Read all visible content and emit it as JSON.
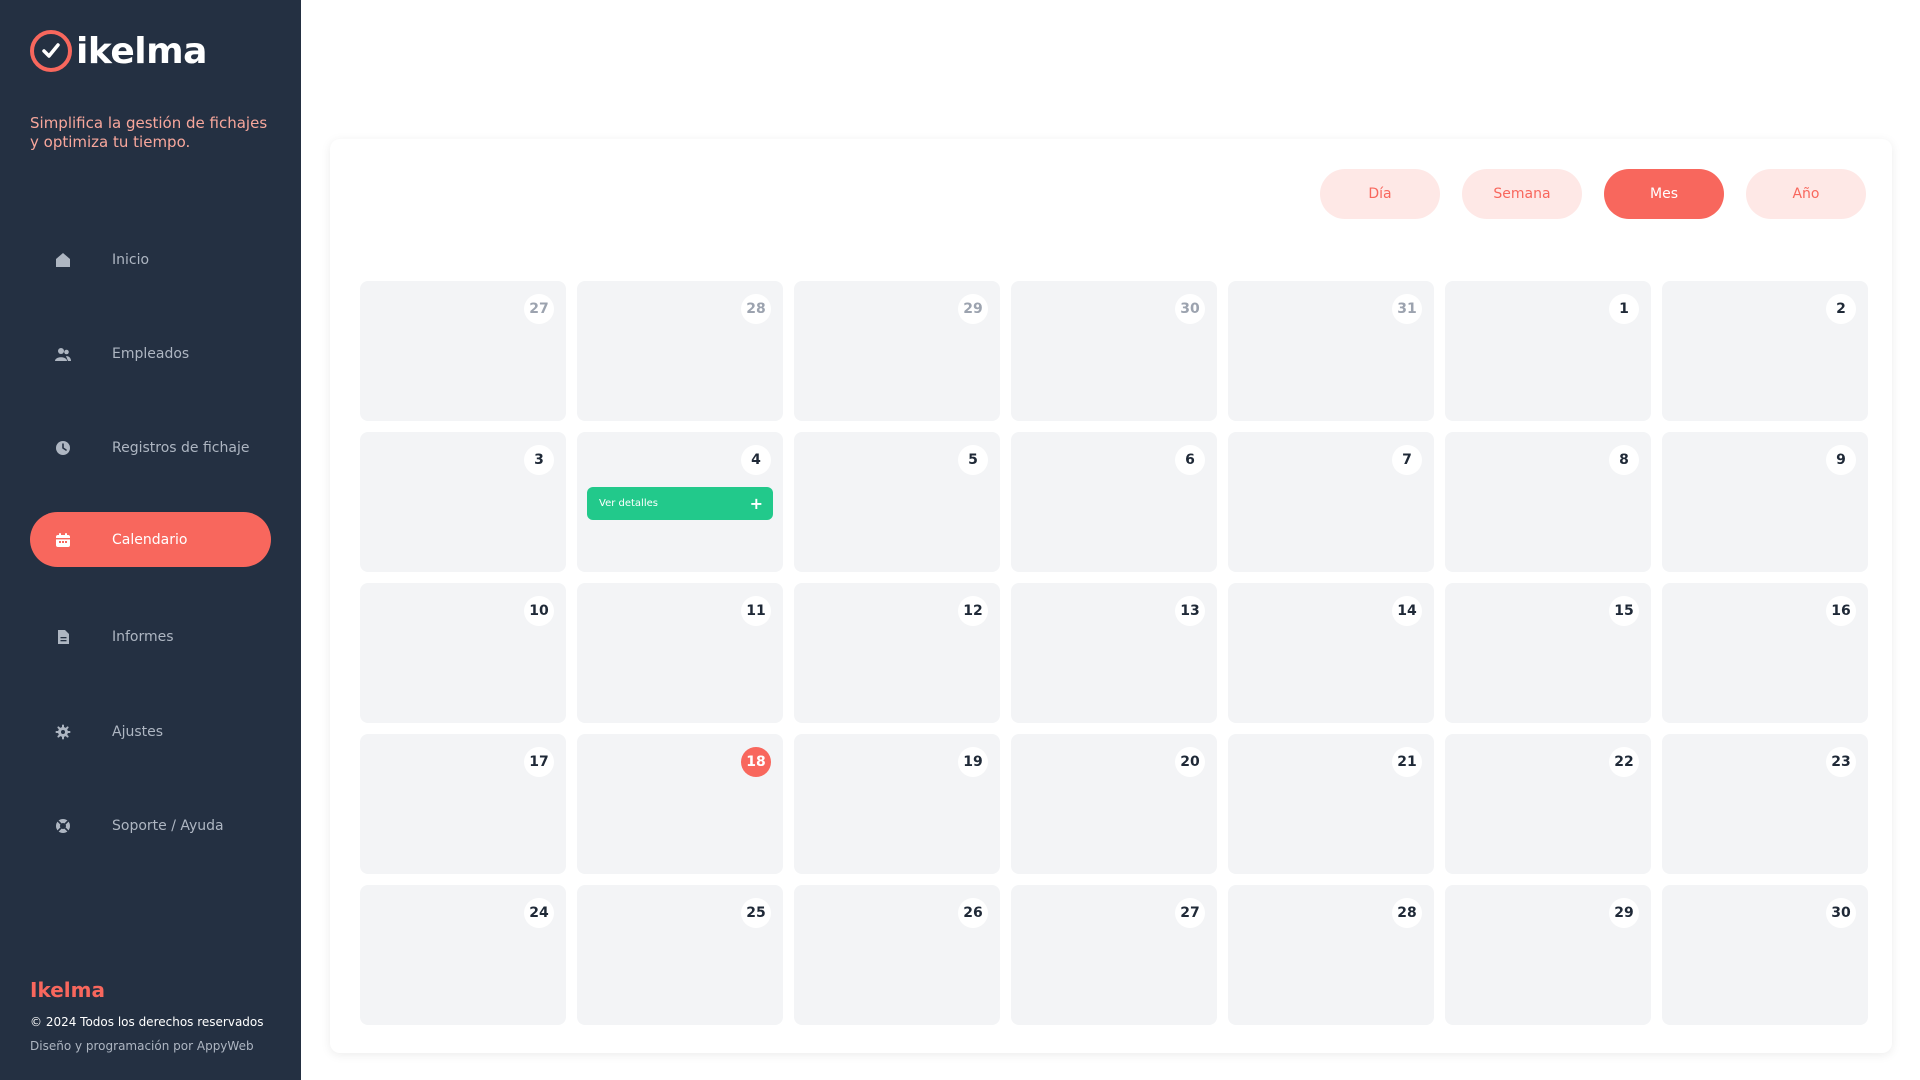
{
  "brand": {
    "name": "ikelma",
    "tagline": "Simplifica la gestión de fichajes y optimiza tu tiempo."
  },
  "nav": {
    "items": [
      {
        "label": "Inicio",
        "icon": "home-icon"
      },
      {
        "label": "Empleados",
        "icon": "users-icon"
      },
      {
        "label": "Registros de fichaje",
        "icon": "clock-icon"
      },
      {
        "label": "Calendario",
        "icon": "calendar-icon",
        "active": true
      },
      {
        "label": "Informes",
        "icon": "file-icon"
      },
      {
        "label": "Ajustes",
        "icon": "gear-icon"
      },
      {
        "label": "Soporte / Ayuda",
        "icon": "lifebuoy-icon"
      }
    ]
  },
  "footer": {
    "brand": "Ikelma",
    "copyright": "© 2024 Todos los derechos reservados",
    "credit": "Diseño y programación por AppyWeb"
  },
  "views": {
    "dia": "Día",
    "semana": "Semana",
    "mes": "Mes",
    "ano": "Año",
    "active": "Mes"
  },
  "calendar": {
    "days": [
      "27",
      "28",
      "29",
      "30",
      "31",
      "1",
      "2",
      "3",
      "4",
      "5",
      "6",
      "7",
      "8",
      "9",
      "10",
      "11",
      "12",
      "13",
      "14",
      "15",
      "16",
      "17",
      "18",
      "19",
      "20",
      "21",
      "22",
      "23",
      "24",
      "25",
      "26",
      "27",
      "28",
      "29",
      "30"
    ],
    "muted_count": 5,
    "today": "18",
    "event": {
      "day": "4",
      "label": "Ver detalles",
      "action": "+"
    }
  },
  "colors": {
    "sidebar": "#243042",
    "accent": "#f8675d",
    "accent_soft": "#fee8e6",
    "event": "#22c98b",
    "cell": "#f3f4f6"
  }
}
